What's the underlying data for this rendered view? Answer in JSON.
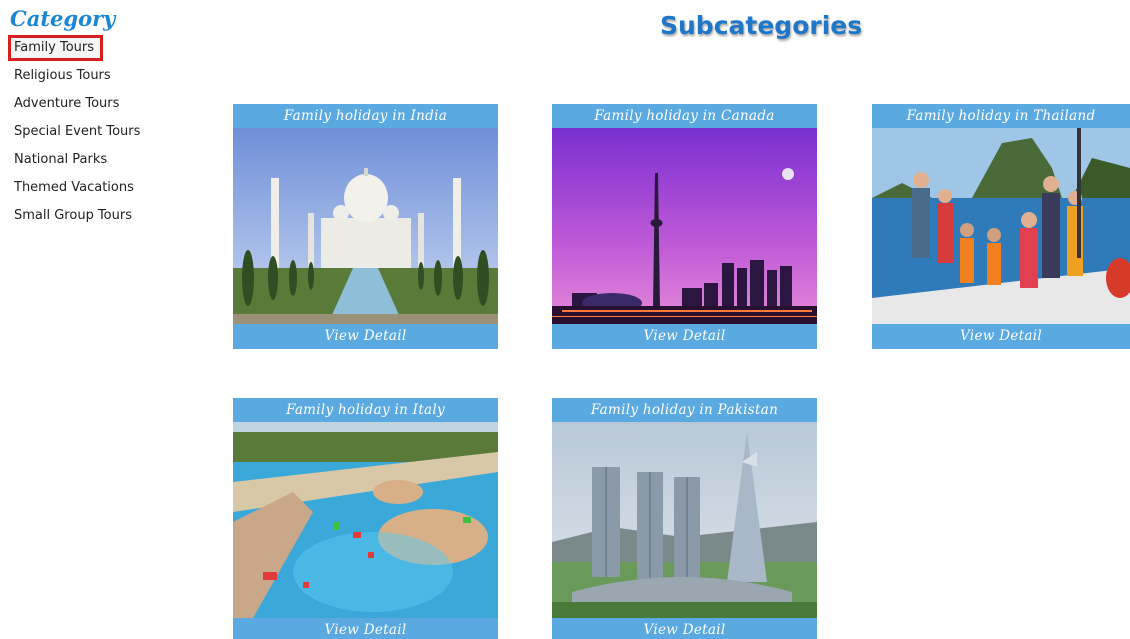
{
  "sidebar": {
    "title": "Category",
    "items": [
      {
        "label": "Family Tours",
        "active": true
      },
      {
        "label": "Religious Tours"
      },
      {
        "label": "Adventure Tours"
      },
      {
        "label": "Special Event Tours"
      },
      {
        "label": "National Parks"
      },
      {
        "label": "Themed Vacations"
      },
      {
        "label": "Small Group Tours"
      }
    ]
  },
  "main": {
    "heading": "Subcategories",
    "cards": [
      {
        "title": "Family holiday in India",
        "detail": "View Detail",
        "image": "taj-mahal-image"
      },
      {
        "title": "Family holiday in Canada",
        "detail": "View Detail",
        "image": "toronto-skyline-image"
      },
      {
        "title": "Family holiday in Thailand",
        "detail": "View Detail",
        "image": "family-boat-image"
      },
      {
        "title": "Family holiday in Italy",
        "detail": "View Detail",
        "image": "water-park-image"
      },
      {
        "title": "Family holiday in Pakistan",
        "detail": "View Detail",
        "image": "towers-image"
      }
    ]
  },
  "colors": {
    "accent": "#1a86d6",
    "card_bar": "#5aa9e0",
    "active_border": "#d62020"
  }
}
